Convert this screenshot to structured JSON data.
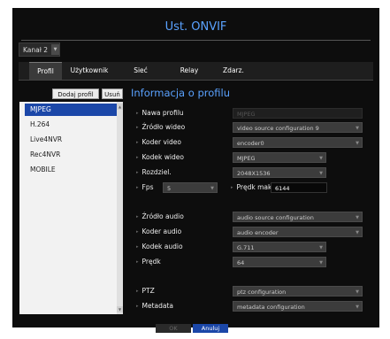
{
  "window": {
    "title": "Ust. ONVIF"
  },
  "channel": {
    "value": "Kanał 2"
  },
  "tabs": [
    {
      "label": "Profil"
    },
    {
      "label": "Użytkownik"
    },
    {
      "label": "Sieć"
    },
    {
      "label": "Relay"
    },
    {
      "label": "Zdarz."
    }
  ],
  "buttons": {
    "add_profile": "Dodaj profil",
    "delete": "Usuń",
    "ok": "OK",
    "cancel": "Anuluj"
  },
  "profiles": [
    "MJPEG",
    "H.264",
    "Live4NVR",
    "Rec4NVR",
    "MOBILE"
  ],
  "selected_profile": "MJPEG",
  "section_title": "Informacja o profilu",
  "form": {
    "profile_name": {
      "label": "Nawa profilu",
      "value": "MJPEG"
    },
    "video_source": {
      "label": "Źródło wideo",
      "value": "video source configuration 9"
    },
    "video_encoder": {
      "label": "Koder video",
      "value": "encoder0"
    },
    "video_codec": {
      "label": "Kodek wideo",
      "value": "MJPEG"
    },
    "resolution": {
      "label": "Rozdziel.",
      "value": "2048X1536"
    },
    "fps": {
      "label": "Fps",
      "value": "5"
    },
    "max_rate": {
      "label": "Prędk maks.",
      "value": "6144"
    },
    "audio_source": {
      "label": "Źródło audio",
      "value": "audio source configuration"
    },
    "audio_encoder": {
      "label": "Koder audio",
      "value": "audio encoder"
    },
    "audio_codec": {
      "label": "Kodek audio",
      "value": "G.711"
    },
    "speed": {
      "label": "Prędk",
      "value": "64"
    },
    "ptz": {
      "label": "PTZ",
      "value": "ptz configuration"
    },
    "metadata": {
      "label": "Metadata",
      "value": "metadata configuration"
    }
  },
  "icons": {
    "dropdown": "chevron-down-icon",
    "bullet": "bullet-icon"
  }
}
